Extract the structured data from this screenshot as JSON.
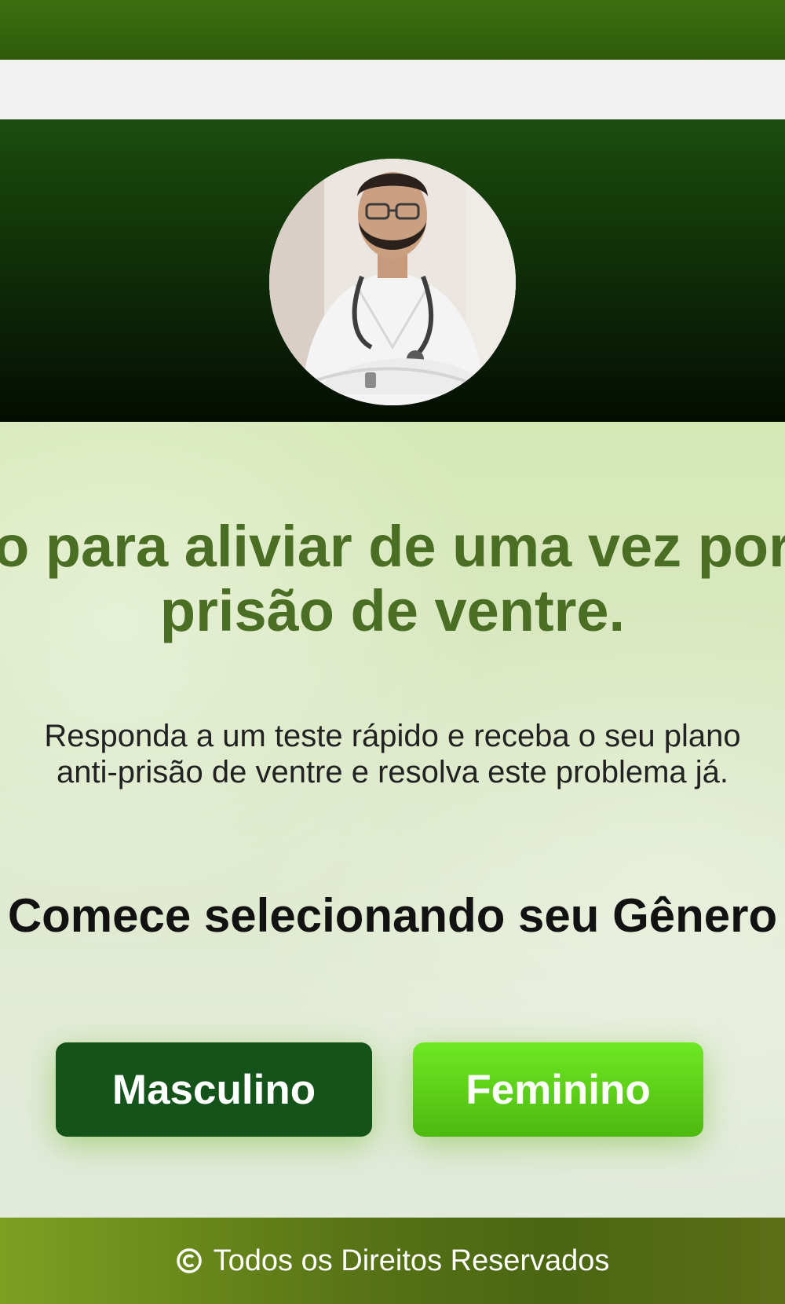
{
  "headline": {
    "line1": "o para aliviar de uma vez por",
    "line2": "prisão de ventre."
  },
  "subtext": {
    "line1": "Responda a um teste rápido e receba o seu plano",
    "line2": "anti-prisão de ventre e resolva este problema já."
  },
  "prompt": "Comece selecionando seu Gênero",
  "buttons": {
    "male": "Masculino",
    "female": "Feminino"
  },
  "footer": {
    "icon": "copyright-icon",
    "text": "Todos os Direitos Reservados"
  },
  "colors": {
    "brand_green": "#4a6e23",
    "male_button": "#14531a",
    "female_button": "#5fd318"
  },
  "avatar": {
    "icon": "doctor-photo"
  }
}
